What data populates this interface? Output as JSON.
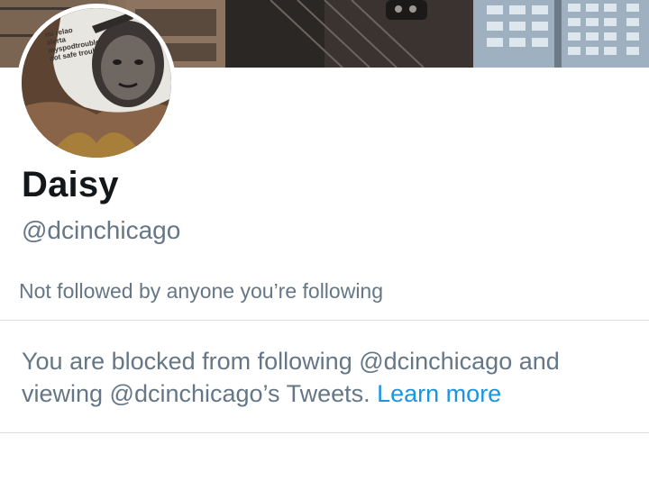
{
  "profile": {
    "display_name": "Daisy",
    "handle": "@dcinchicago",
    "followers_note": "Not followed by anyone you’re following",
    "blocked_text": "You are blocked from following @dcinchicago and viewing @dcinchicago’s Tweets.",
    "learn_more": "Learn more"
  },
  "avatar_mask_text": [
    "mi relao",
    "alerta",
    "myspodtrouble.",
    "Not safe troubla"
  ],
  "colors": {
    "link": "#1b95e0",
    "secondary_text": "#657786",
    "primary_text": "#14171a",
    "divider": "#d9dee3"
  }
}
